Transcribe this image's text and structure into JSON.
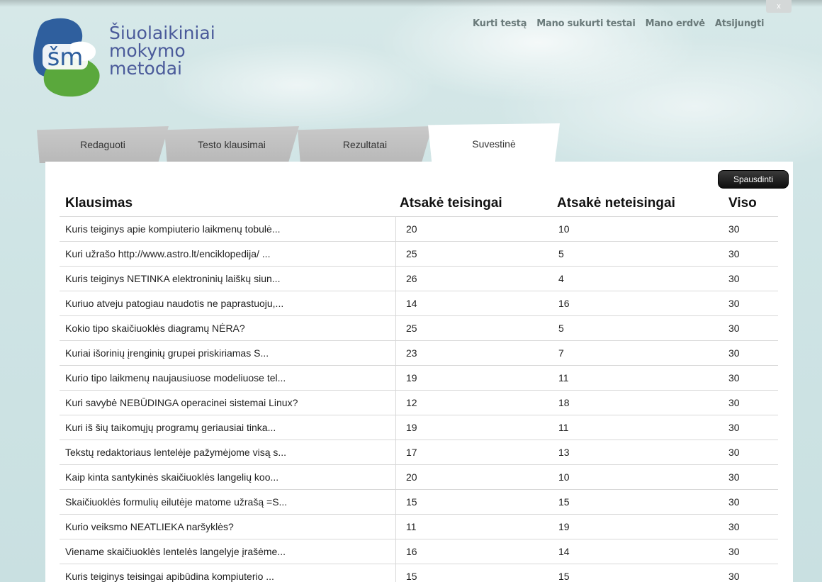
{
  "logo": {
    "lines": [
      "Šiuolaikiniai",
      "mokymo",
      "metodai"
    ],
    "mark_text": "šm"
  },
  "close_label": "x",
  "nav": [
    "Kurti testą",
    "Mano sukurti testai",
    "Mano erdvė",
    "Atsijungti"
  ],
  "tabs": [
    "Redaguoti",
    "Testo klausimai",
    "Rezultatai",
    "Suvestinė"
  ],
  "print_label": "Spausdinti",
  "table": {
    "headers": [
      "Klausimas",
      "Atsakė teisingai",
      "Atsakė neteisingai",
      "Viso"
    ],
    "rows": [
      [
        "Kuris teiginys apie kompiuterio laikmenų tobulė...",
        "20",
        "10",
        "30"
      ],
      [
        "Kuri užrašo http://www.astro.lt/enciklopedija/ ...",
        "25",
        "5",
        "30"
      ],
      [
        "Kuris teiginys NETINKA elektroninių laiškų siun...",
        "26",
        "4",
        "30"
      ],
      [
        "Kuriuo atveju patogiau naudotis ne paprastuoju,...",
        "14",
        "16",
        "30"
      ],
      [
        "Kokio tipo skaičiuoklės diagramų NĖRA?",
        "25",
        "5",
        "30"
      ],
      [
        "Kuriai išorinių įrenginių grupei priskiriamas S...",
        "23",
        "7",
        "30"
      ],
      [
        "Kurio tipo laikmenų naujausiuose modeliuose tel...",
        "19",
        "11",
        "30"
      ],
      [
        "Kuri savybė NEBŪDINGA operacinei sistemai Linux?",
        "12",
        "18",
        "30"
      ],
      [
        "Kuri iš šių taikomųjų programų geriausiai tinka...",
        "19",
        "11",
        "30"
      ],
      [
        "Tekstų redaktoriaus lentelėje pažymėjome visą s...",
        "17",
        "13",
        "30"
      ],
      [
        "Kaip kinta santykinės skaičiuoklės langelių koo...",
        "20",
        "10",
        "30"
      ],
      [
        "Skaičiuoklės formulių eilutėje matome užrašą =S...",
        "15",
        "15",
        "30"
      ],
      [
        "Kurio veiksmo NEATLIEKA naršyklės?",
        "11",
        "19",
        "30"
      ],
      [
        "Viename skaičiuoklės lentelės langelyje įrašėme...",
        "16",
        "14",
        "30"
      ],
      [
        "Kuris teiginys teisingai apibūdina kompiuterio ...",
        "15",
        "15",
        "30"
      ]
    ]
  },
  "colors": {
    "logo_blue": "#2f5f9e",
    "logo_green": "#5aa83c",
    "logo_text": "#4a5a9a",
    "nav_text": "#6a7a7a",
    "tab_gray": "#c4c4c4",
    "background": "#cfe4e5"
  }
}
